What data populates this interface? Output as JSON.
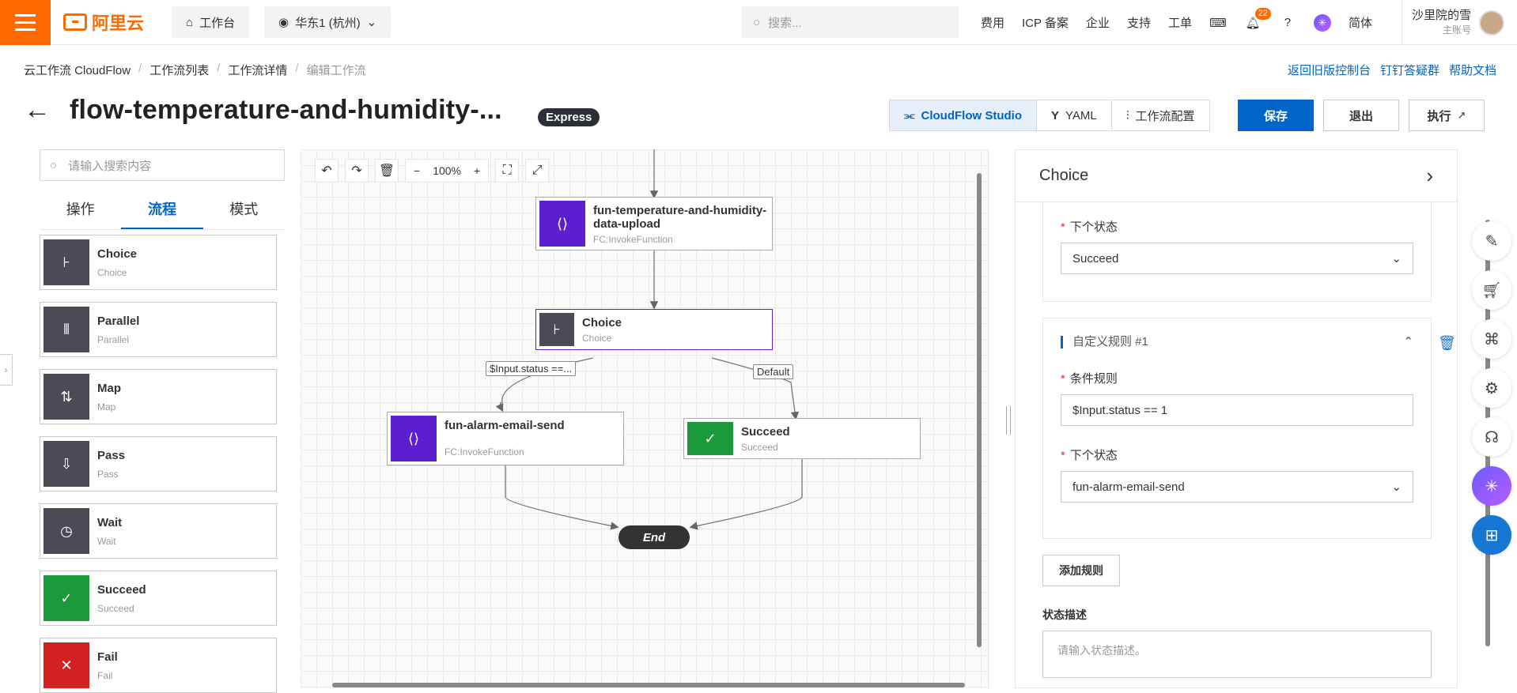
{
  "topbar": {
    "logo_text": "阿里云",
    "workbench": "工作台",
    "region": "华东1 (杭州)",
    "search_placeholder": "搜索...",
    "nav": [
      "费用",
      "ICP 备案",
      "企业",
      "支持",
      "工单"
    ],
    "notification_count": "22",
    "lang": "简体",
    "user_name": "沙里院的雪",
    "user_role": "主账号"
  },
  "breadcrumb": [
    "云工作流 CloudFlow",
    "工作流列表",
    "工作流详情",
    "编辑工作流"
  ],
  "top_links": [
    "返回旧版控制台",
    "钉钉答疑群",
    "帮助文档"
  ],
  "page": {
    "title": "flow-temperature-and-humidity-...",
    "badge": "Express"
  },
  "toolbar": {
    "studio": "CloudFlow Studio",
    "yaml": "YAML",
    "config": "工作流配置",
    "save": "保存",
    "exit": "退出",
    "run": "执行"
  },
  "left": {
    "search_placeholder": "请输入搜索内容",
    "tabs": [
      "操作",
      "流程",
      "模式"
    ],
    "items": [
      {
        "name": "Choice",
        "type": "Choice",
        "color": "#4a4b55",
        "icon": "choice-icon"
      },
      {
        "name": "Parallel",
        "type": "Parallel",
        "color": "#4a4b55",
        "icon": "parallel-icon"
      },
      {
        "name": "Map",
        "type": "Map",
        "color": "#4a4b55",
        "icon": "map-icon"
      },
      {
        "name": "Pass",
        "type": "Pass",
        "color": "#4a4b55",
        "icon": "pass-icon"
      },
      {
        "name": "Wait",
        "type": "Wait",
        "color": "#4a4b55",
        "icon": "wait-icon"
      },
      {
        "name": "Succeed",
        "type": "Succeed",
        "color": "#1a9a3a",
        "icon": "check-icon"
      },
      {
        "name": "Fail",
        "type": "Fail",
        "color": "#d32020",
        "icon": "x-icon"
      }
    ]
  },
  "canvas": {
    "zoom": "100%",
    "nodes": {
      "upload": {
        "name": "fun-temperature-and-humidity-data-upload",
        "type": "FC:InvokeFunction",
        "color": "#5b1fd0"
      },
      "choice": {
        "name": "Choice",
        "type": "Choice",
        "color": "#4a4b55"
      },
      "alarm": {
        "name": "fun-alarm-email-send",
        "type": "FC:InvokeFunction",
        "color": "#5b1fd0"
      },
      "succeed": {
        "name": "Succeed",
        "type": "Succeed",
        "color": "#1a9a3a"
      },
      "end": "End"
    },
    "edge_labels": {
      "rule": "$Input.status ==...",
      "default": "Default"
    }
  },
  "right": {
    "title": "Choice",
    "next_state_label": "下个状态",
    "next_state_default": "Succeed",
    "rule_title": "自定义规则 #1",
    "condition_label": "条件规则",
    "condition_value": "$Input.status == 1",
    "rule_next_state_label": "下个状态",
    "rule_next_state": "fun-alarm-email-send",
    "add_rule": "添加规则",
    "desc_label": "状态描述",
    "desc_placeholder": "请输入状态描述。"
  }
}
